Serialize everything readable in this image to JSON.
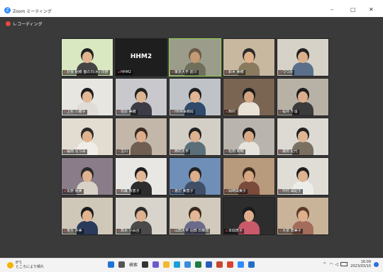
{
  "window": {
    "title": "Zoom ミーティング",
    "controls": {
      "minimize": "–",
      "restore": "▢",
      "close": "✕"
    },
    "recording_label": "レコーディング",
    "app_icon_glyph": "Z"
  },
  "colors": {
    "recording": "#e8493e",
    "active_speaker_border": "#8fd14f",
    "zoom_blue": "#2d8cff"
  },
  "participants": [
    {
      "name": "計良 稲穂 猫の日(水) 日野",
      "bg": "#d9e8c0",
      "skin": "#e2b58f",
      "hair": "#222",
      "shirt": "#444"
    },
    {
      "name": "HHM2",
      "display_text": "HHM2",
      "no_video": true,
      "bg": "#1e1e1e"
    },
    {
      "name": "東京大学 前川",
      "bg": "#9b9c8a",
      "skin": "#c49a75",
      "hair": "#6b5a48",
      "shirt": "#6f6f5c",
      "active": true
    },
    {
      "name": "鈴木 美穂",
      "bg": "#c8b89f",
      "skin": "#e0b18a",
      "hair": "#2b2b2b",
      "shirt": "#8a7a5e"
    },
    {
      "name": "つつみ",
      "bg": "#d7d2c8",
      "skin": "#deb08a",
      "hair": "#222",
      "shirt": "#5a6f8a"
    },
    {
      "name": "上杉 八穂子",
      "bg": "#e7e6e1",
      "skin": "#e3b896",
      "hair": "#1d1d1d",
      "shirt": "#e0ddd8"
    },
    {
      "name": "佐原 美穂",
      "bg": "#c9c9cd",
      "skin": "#dfb492",
      "hair": "#222",
      "shirt": "#3c3c46"
    },
    {
      "name": "HHM事務局",
      "bg": "#bfc3c8",
      "skin": "#e1b692",
      "hair": "#202020",
      "shirt": "#2f4a6a"
    },
    {
      "name": "西村",
      "bg": "#7a6452",
      "skin": "#d4a582",
      "hair": "#1b1b1b",
      "shirt": "#e8e1d6"
    },
    {
      "name": "桜井 千尋",
      "bg": "#b8b1a6",
      "skin": "#dcae8c",
      "hair": "#1e1e1e",
      "shirt": "#3b3b3b"
    },
    {
      "name": "桜田 なつみ",
      "bg": "#e3ddd1",
      "skin": "#e2b38e",
      "hair": "#2b2b2b",
      "shirt": "#f0ede8"
    },
    {
      "name": "古川",
      "bg": "#c2b7a9",
      "skin": "#dcae8c",
      "hair": "#3a2a20",
      "shirt": "#6f5e52"
    },
    {
      "name": "西村大学",
      "bg": "#d3cfc7",
      "skin": "#deb190",
      "hair": "#222",
      "shirt": "#5b6f7a"
    },
    {
      "name": "松田 明明",
      "bg": "#b9b4ad",
      "skin": "#d9aa86",
      "hair": "#1c1c1c",
      "shirt": "#e6e3dd"
    },
    {
      "name": "森田 紀代",
      "bg": "#ddd9d3",
      "skin": "#e2b592",
      "hair": "#222",
      "shirt": "#7a7062"
    },
    {
      "name": "矢野 朋美",
      "bg": "#8a7c88",
      "skin": "#e0b391",
      "hair": "#2a2a2a",
      "shirt": "#d8d1c8"
    },
    {
      "name": "石森 香恵子",
      "bg": "#e9e7e3",
      "skin": "#e3b796",
      "hair": "#1d1d1d",
      "shirt": "#2d2d2d"
    },
    {
      "name": "渡辺 美恵子",
      "bg": "#6f8fb8",
      "skin": "#dcae8c",
      "hair": "#222",
      "shirt": "#404f66"
    },
    {
      "name": "岡崎由美子",
      "bg": "#b89a7c",
      "skin": "#d9a883",
      "hair": "#3a2a1e",
      "shirt": "#7a4a3a"
    },
    {
      "name": "中村 由紀子",
      "bg": "#e0ddd6",
      "skin": "#e0b391",
      "hair": "#1f1f1f",
      "shirt": "#ecece9"
    },
    {
      "name": "荒生 井美",
      "bg": "#cfc7b8",
      "skin": "#e2b490",
      "hair": "#1b1b1b",
      "shirt": "#2a3a5a"
    },
    {
      "name": "高木 小百合",
      "bg": "#d8d4cc",
      "skin": "#dfb18e",
      "hair": "#2b2b2b",
      "shirt": "#4a4a4a"
    },
    {
      "name": "山田大学 羽田 日菜向",
      "bg": "#d1cabd",
      "skin": "#e3b795",
      "hair": "#3a2a20",
      "shirt": "#6a6a8a"
    },
    {
      "name": "本間恵子",
      "bg": "#2d2d2d",
      "skin": "#dcae8c",
      "hair": "#1a1a1a",
      "shirt": "#c85a6a"
    },
    {
      "name": "大泉 恵美子",
      "bg": "#c9b49a",
      "skin": "#deb08c",
      "hair": "#5a3a28",
      "shirt": "#a46c5a"
    }
  ],
  "taskbar": {
    "weather_temp": "8°C",
    "weather_text": "ところにより晴れ",
    "search_text": "検索",
    "time": "16:09",
    "date": "2023/03/10"
  },
  "taskbar_apps": [
    {
      "icon": "windows-start-icon",
      "color": "#1e74d6"
    },
    {
      "icon": "search-icon",
      "color": "#555555"
    },
    {
      "icon": "task-view-icon",
      "color": "#333333"
    },
    {
      "icon": "chat-icon",
      "color": "#6a5acd"
    },
    {
      "icon": "file-explorer-icon",
      "color": "#f1b92d"
    },
    {
      "icon": "edge-icon",
      "color": "#1a9fd8"
    },
    {
      "icon": "store-icon",
      "color": "#3c8bdb"
    },
    {
      "icon": "excel-icon",
      "color": "#1f7a43"
    },
    {
      "icon": "word-icon",
      "color": "#2b5bb8"
    },
    {
      "icon": "powerpoint-icon",
      "color": "#c9472b"
    },
    {
      "icon": "chrome-icon",
      "color": "#d9432f"
    },
    {
      "icon": "zoom-icon",
      "color": "#2d8cff"
    },
    {
      "icon": "mail-icon",
      "color": "#2070c8"
    }
  ]
}
